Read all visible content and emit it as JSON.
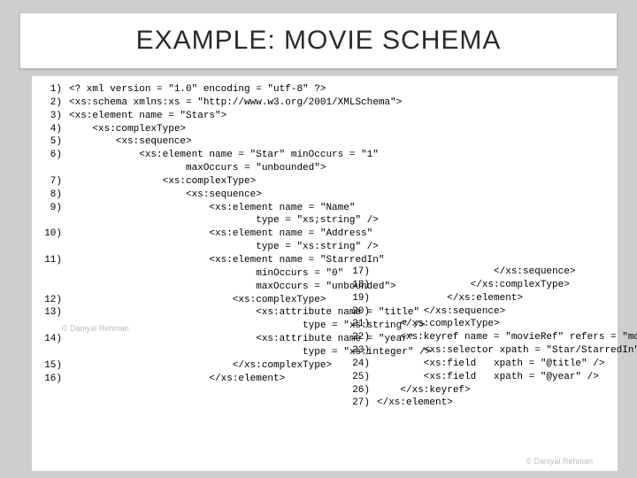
{
  "title": "EXAMPLE: MOVIE SCHEMA",
  "watermark": "© Daniyal Rehman",
  "left_lines": [
    {
      "n": "1)",
      "t": "<? xml version = \"1.0\" encoding = \"utf-8\" ?>"
    },
    {
      "n": "2)",
      "t": "<xs:schema xmlns:xs = \"http://www.w3.org/2001/XMLSchema\">"
    },
    {
      "n": "",
      "t": ""
    },
    {
      "n": "3)",
      "t": "<xs:element name = \"Stars\">"
    },
    {
      "n": "",
      "t": ""
    },
    {
      "n": "4)",
      "t": "    <xs:complexType>"
    },
    {
      "n": "5)",
      "t": "        <xs:sequence>"
    },
    {
      "n": "6)",
      "t": "            <xs:element name = \"Star\" minOccurs = \"1\""
    },
    {
      "n": "",
      "t": "                    maxOccurs = \"unbounded\">"
    },
    {
      "n": "7)",
      "t": "                <xs:complexType>"
    },
    {
      "n": "8)",
      "t": "                    <xs:sequence>"
    },
    {
      "n": "9)",
      "t": "                        <xs:element name = \"Name\""
    },
    {
      "n": "",
      "t": "                                type = \"xs;string\" />"
    },
    {
      "n": "10)",
      "t": "                        <xs:element name = \"Address\""
    },
    {
      "n": "",
      "t": "                                type = \"xs:string\" />"
    },
    {
      "n": "11)",
      "t": "                        <xs:element name = \"StarredIn\""
    },
    {
      "n": "",
      "t": "                                minOccurs = \"0\""
    },
    {
      "n": "",
      "t": "                                maxOccurs = \"unbounded\">"
    },
    {
      "n": "12)",
      "t": "                            <xs:complexType>"
    },
    {
      "n": "13)",
      "t": "                                <xs:attribute name = \"title\""
    },
    {
      "n": "",
      "t": "                                        type = \"xs:string\" />"
    },
    {
      "n": "14)",
      "t": "                                <xs:attribute name = \"year\""
    },
    {
      "n": "",
      "t": "                                        type = \"xs:integer\" />"
    },
    {
      "n": "15)",
      "t": "                            </xs:complexType>"
    },
    {
      "n": "16)",
      "t": "                        </xs:element>"
    }
  ],
  "right_lines": [
    {
      "n": "17)",
      "t": "                    </xs:sequence>"
    },
    {
      "n": "18)",
      "t": "                </xs:complexType>"
    },
    {
      "n": "19)",
      "t": "            </xs:element>"
    },
    {
      "n": "20)",
      "t": "        </xs:sequence>"
    },
    {
      "n": "21)",
      "t": "    </xs:complexType>"
    },
    {
      "n": "",
      "t": ""
    },
    {
      "n": "22)",
      "t": "    <xs:keyref name = \"movieRef\" refers = \"movieKey\">"
    },
    {
      "n": "23)",
      "t": "        <xs:selector xpath = \"Star/StarredIn\" />"
    },
    {
      "n": "24)",
      "t": "        <xs:field   xpath = \"@title\" />"
    },
    {
      "n": "25)",
      "t": "        <xs:field   xpath = \"@year\" />"
    },
    {
      "n": "26)",
      "t": "    </xs:keyref>"
    },
    {
      "n": "",
      "t": ""
    },
    {
      "n": "27)",
      "t": "</xs:element>"
    }
  ]
}
